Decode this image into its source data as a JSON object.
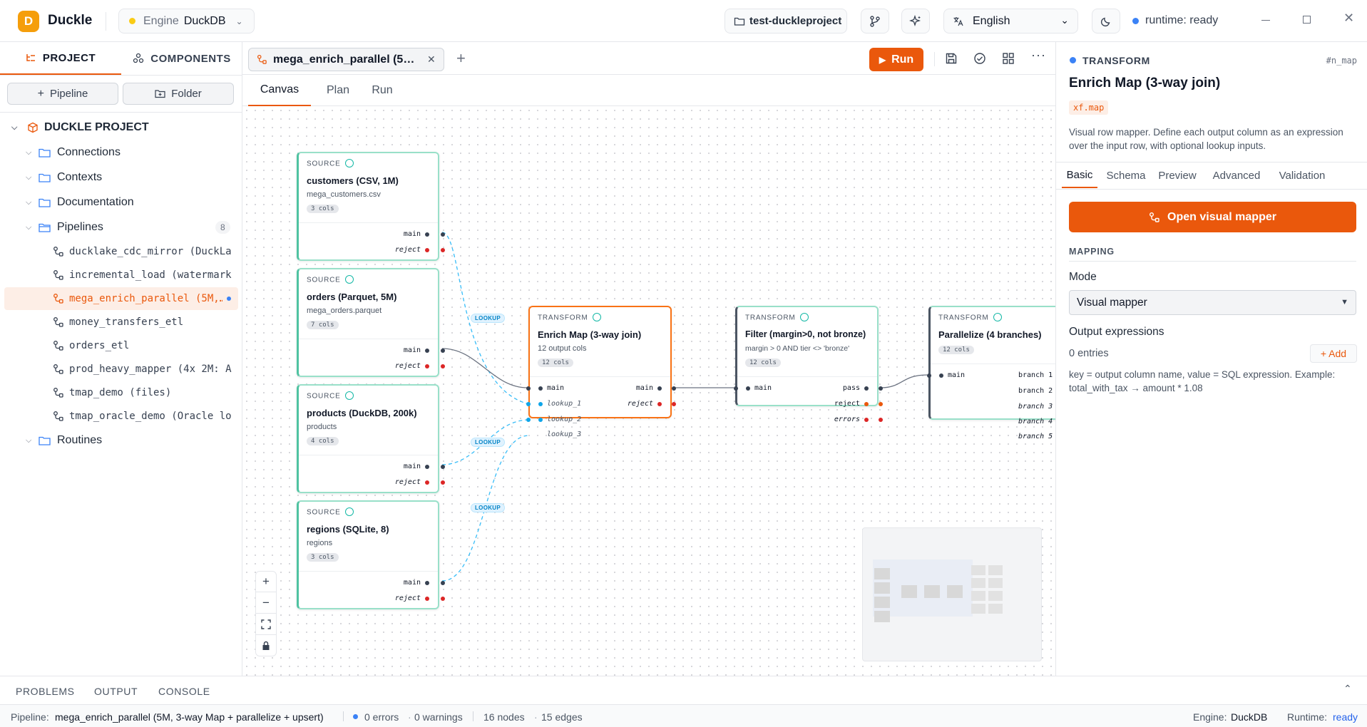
{
  "app": {
    "name": "Duckle",
    "logo_letter": "D"
  },
  "topbar": {
    "engine_label": "Engine",
    "engine_value": "DuckDB",
    "project_name": "test-duckleproject",
    "language": "English",
    "runtime_status": "runtime: ready"
  },
  "left": {
    "tabs": [
      "PROJECT",
      "COMPONENTS"
    ],
    "buttons": [
      "Pipeline",
      "Folder"
    ],
    "root": "DUCKLE PROJECT",
    "folders": {
      "connections": "Connections",
      "contexts": "Contexts",
      "documentation": "Documentation",
      "pipelines": "Pipelines",
      "routines": "Routines"
    },
    "pipelines_count": "8",
    "pipelines": [
      "ducklake_cdc_mirror (DuckLa…",
      "incremental_load (watermark…",
      "mega_enrich_parallel (5M,…",
      "money_transfers_etl",
      "orders_etl",
      "prod_heavy_mapper (4x 2M: A…",
      "tmap_demo (files)",
      "tmap_oracle_demo (Oracle lo…"
    ]
  },
  "editor": {
    "tab_title": "mega_enrich_parallel (5…",
    "run_label": "Run",
    "subtabs": [
      "Canvas",
      "Plan",
      "Run"
    ]
  },
  "canvas": {
    "nodes": {
      "customers": {
        "kind": "SOURCE",
        "title": "customers (CSV, 1M)",
        "sub": "mega_customers.csv",
        "badge": "3 cols",
        "ports": [
          "main",
          "reject"
        ]
      },
      "orders": {
        "kind": "SOURCE",
        "title": "orders (Parquet, 5M)",
        "sub": "mega_orders.parquet",
        "badge": "7 cols",
        "ports": [
          "main",
          "reject"
        ]
      },
      "products": {
        "kind": "SOURCE",
        "title": "products (DuckDB, 200k)",
        "sub": "products",
        "badge": "4 cols",
        "ports": [
          "main",
          "reject"
        ]
      },
      "regions": {
        "kind": "SOURCE",
        "title": "regions (SQLite, 8)",
        "sub": "regions",
        "badge": "3 cols",
        "ports": [
          "main",
          "reject"
        ]
      },
      "enrich": {
        "kind": "TRANSFORM",
        "title": "Enrich Map (3-way join)",
        "sub": "12 output cols",
        "badge": "12 cols",
        "inputs": [
          "main",
          "lookup_1",
          "lookup_2",
          "lookup_3"
        ],
        "outputs": [
          "main",
          "reject"
        ]
      },
      "filter": {
        "kind": "TRANSFORM",
        "title": "Filter (margin>0, not bronze)",
        "sub": "margin > 0 AND tier <> 'bronze'",
        "badge": "12 cols",
        "inputs": [
          "main"
        ],
        "outputs": [
          "pass",
          "reject",
          "errors"
        ]
      },
      "parallel": {
        "kind": "TRANSFORM",
        "title": "Parallelize (4 branches)",
        "badge": "12 cols",
        "inputs": [
          "main"
        ],
        "outputs": [
          "branch 1",
          "branch 2",
          "branch 3",
          "branch 4",
          "branch 5"
        ]
      }
    },
    "edge_label": "LOOKUP"
  },
  "inspector": {
    "kind": "TRANSFORM",
    "node_id": "#n_map",
    "title": "Enrich Map (3-way join)",
    "type_code": "xf.map",
    "description": "Visual row mapper. Define each output column as an expression over the input row, with optional lookup inputs.",
    "tabs": [
      "Basic",
      "Schema",
      "Preview",
      "Advanced",
      "Validation"
    ],
    "open_mapper": "Open visual mapper",
    "section": "MAPPING",
    "mode_label": "Mode",
    "mode_value": "Visual mapper",
    "output_label": "Output expressions",
    "entries": "0 entries",
    "add_label": "+ Add",
    "hint": "key = output column name, value = SQL expression. Example: total_with_tax → amount * 1.08"
  },
  "bottom": {
    "tabs": [
      "PROBLEMS",
      "OUTPUT",
      "CONSOLE"
    ]
  },
  "status": {
    "pipeline_label": "Pipeline:",
    "pipeline_value": "mega_enrich_parallel (5M, 3-way Map + parallelize + upsert)",
    "errors": "0 errors",
    "warnings": "0 warnings",
    "nodes": "16 nodes",
    "edges": "15 edges",
    "engine_label": "Engine:",
    "engine_value": "DuckDB",
    "runtime_label": "Runtime:",
    "runtime_value": "ready"
  },
  "colors": {
    "accent": "#ea580c",
    "node_border": "#99e0c9",
    "selected_border": "#f97316",
    "link": "#2563eb",
    "reject_port": "#dc2626",
    "lookup_port": "#0ea5e9"
  }
}
